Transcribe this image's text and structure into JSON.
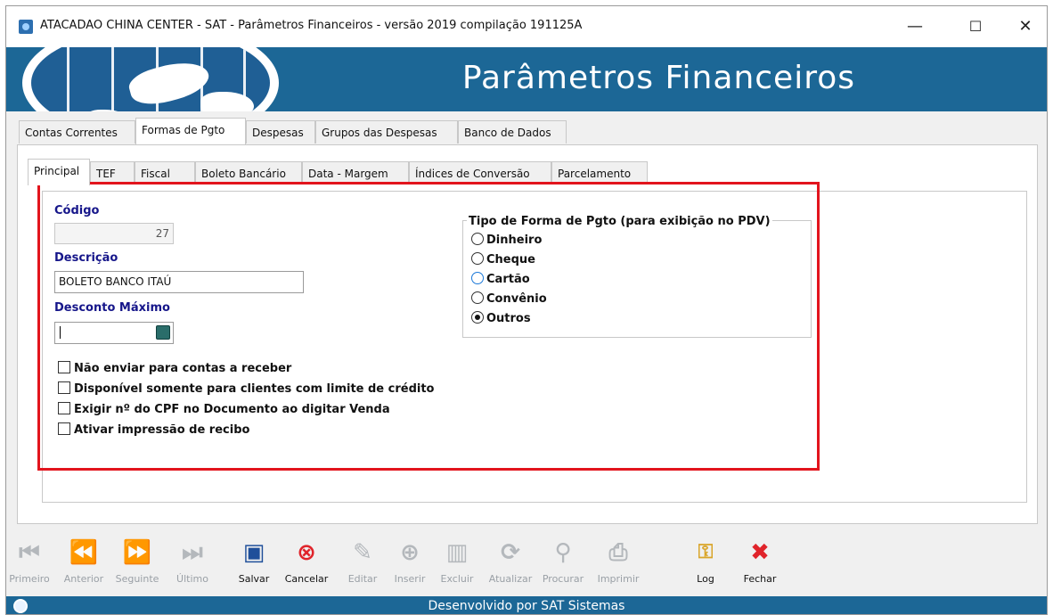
{
  "window": {
    "title": "ATACADAO CHINA CENTER - SAT - Parâmetros Financeiros - versão 2019 compilação 191125A",
    "minimize": "—",
    "maximize": "☐",
    "close": "✕"
  },
  "banner": {
    "title": "Parâmetros Financeiros"
  },
  "main_tabs": [
    "Contas Correntes",
    "Formas de Pgto",
    "Despesas",
    "Grupos das Despesas",
    "Banco de Dados"
  ],
  "main_tab_active": "Formas de Pgto",
  "sub_tabs": [
    "Principal",
    "TEF",
    "Fiscal",
    "Boleto Bancário",
    "Data - Margem",
    "Índices de Conversão",
    "Parcelamento"
  ],
  "sub_tab_active": "Principal",
  "form": {
    "codigo_label": "Código",
    "codigo_value": "27",
    "descricao_label": "Descrição",
    "descricao_value": "BOLETO BANCO ITAÚ",
    "desconto_label": "Desconto Máximo",
    "desconto_value": "",
    "checkboxes": [
      {
        "label": "Não enviar para contas a receber",
        "checked": false
      },
      {
        "label": "Disponível somente para clientes com limite de crédito",
        "checked": false
      },
      {
        "label": "Exigir nº do CPF no Documento ao digitar Venda",
        "checked": false
      },
      {
        "label": "Ativar impressão de recibo",
        "checked": false
      }
    ]
  },
  "tipo_group": {
    "title": "Tipo de Forma de Pgto (para exibição no PDV)",
    "options": [
      "Dinheiro",
      "Cheque",
      "Cartão",
      "Convênio",
      "Outros"
    ],
    "selected": "Outros"
  },
  "toolbar": {
    "buttons": [
      {
        "label": "Primeiro",
        "icon": "first-icon",
        "enabled": false
      },
      {
        "label": "Anterior",
        "icon": "previous-icon",
        "enabled": false
      },
      {
        "label": "Seguinte",
        "icon": "next-icon",
        "enabled": false
      },
      {
        "label": "Último",
        "icon": "last-icon",
        "enabled": false
      },
      {
        "label": "Salvar",
        "icon": "save-icon",
        "enabled": true
      },
      {
        "label": "Cancelar",
        "icon": "cancel-icon",
        "enabled": true
      },
      {
        "label": "Editar",
        "icon": "edit-icon",
        "enabled": false
      },
      {
        "label": "Inserir",
        "icon": "insert-icon",
        "enabled": false
      },
      {
        "label": "Excluir",
        "icon": "delete-icon",
        "enabled": false
      },
      {
        "label": "Atualizar",
        "icon": "refresh-icon",
        "enabled": false
      },
      {
        "label": "Procurar",
        "icon": "search-icon",
        "enabled": false
      },
      {
        "label": "Imprimir",
        "icon": "print-icon",
        "enabled": false
      },
      {
        "label": "Log",
        "icon": "key-icon",
        "enabled": true
      },
      {
        "label": "Fechar",
        "icon": "close-icon",
        "enabled": true
      }
    ]
  },
  "status": {
    "text": "Desenvolvido por SAT Sistemas"
  },
  "colors": {
    "banner": "#1c6796",
    "highlight": "#e2141d",
    "label": "#16168a",
    "cancel": "#e0242b",
    "save": "#1f4f9a"
  }
}
